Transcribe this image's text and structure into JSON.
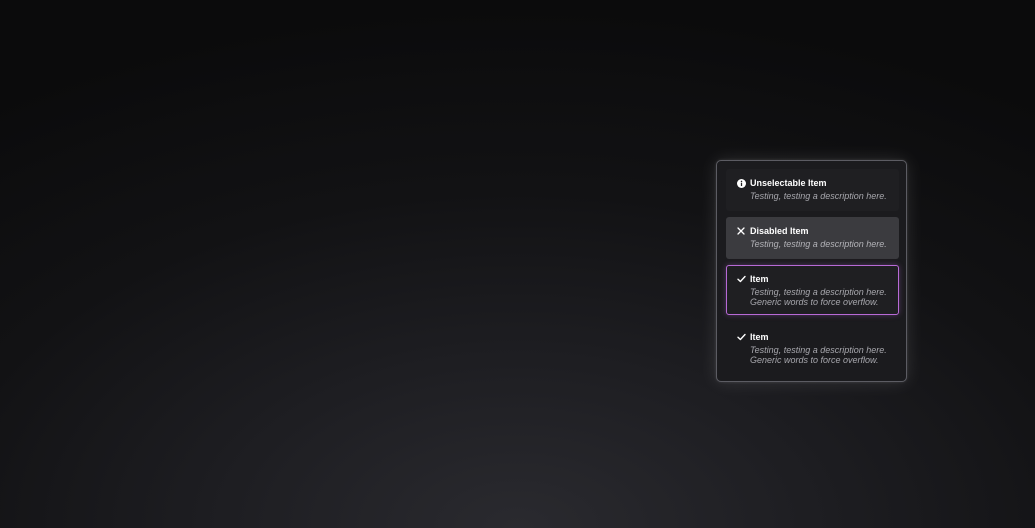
{
  "menu": {
    "items": [
      {
        "label": "Unselectable Item",
        "description": "Testing, testing a description here.",
        "icon": "info-icon"
      },
      {
        "label": "Disabled Item",
        "description": "Testing, testing a description here.",
        "icon": "close-icon"
      },
      {
        "label": "Item",
        "description": "Testing, testing a description here. Generic words to force overflow.",
        "icon": "check-icon"
      },
      {
        "label": "Item",
        "description": "Testing, testing a description here. Generic words to force overflow.",
        "icon": "check-icon"
      }
    ],
    "colors": {
      "focus_border": "#b86ad6",
      "disabled_bg": "#3b3b3f",
      "panel_border": "#5c5c63"
    }
  }
}
